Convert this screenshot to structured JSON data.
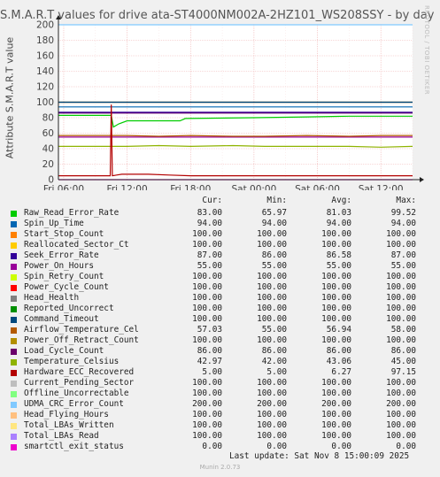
{
  "chart_data": {
    "type": "line",
    "title": "S.M.A.R.T values for drive ata-ST4000NM002A-2HZ101_WS208SSY - by day",
    "ylabel": "Attribute S.M.A.R.T value",
    "ylim": [
      0,
      200
    ],
    "yticks": [
      0,
      20,
      40,
      60,
      80,
      100,
      120,
      140,
      160,
      180,
      200
    ],
    "xlim_hours": [
      -33.5,
      0
    ],
    "x_ticks": [
      "Fri 06:00",
      "Fri 12:00",
      "Fri 18:00",
      "Sat 00:00",
      "Sat 06:00",
      "Sat 12:00"
    ],
    "grid": true,
    "series": [
      {
        "name": "Raw_Read_Error_Rate",
        "color": "#00cc00",
        "constant": null
      },
      {
        "name": "Spin_Up_Time",
        "color": "#0066b3",
        "constant": 94
      },
      {
        "name": "Start_Stop_Count",
        "color": "#ff8000",
        "constant": 100
      },
      {
        "name": "Reallocated_Sector_Ct",
        "color": "#ffcc00",
        "constant": 100
      },
      {
        "name": "Seek_Error_Rate",
        "color": "#330099",
        "constant": null
      },
      {
        "name": "Power_On_Hours",
        "color": "#990099",
        "constant": 55
      },
      {
        "name": "Spin_Retry_Count",
        "color": "#ccff00",
        "constant": 100
      },
      {
        "name": "Power_Cycle_Count",
        "color": "#ff0000",
        "constant": 100
      },
      {
        "name": "Head_Health",
        "color": "#808080",
        "constant": 100
      },
      {
        "name": "Reported_Uncorrect",
        "color": "#008f00",
        "constant": 100
      },
      {
        "name": "Command_Timeout",
        "color": "#00487d",
        "constant": 100
      },
      {
        "name": "Airflow_Temperature_Cel",
        "color": "#b35a00",
        "constant": null
      },
      {
        "name": "Power_Off_Retract_Count",
        "color": "#b38f00",
        "constant": 100
      },
      {
        "name": "Load_Cycle_Count",
        "color": "#6b006b",
        "constant": 86
      },
      {
        "name": "Temperature_Celsius",
        "color": "#8fb300",
        "constant": null
      },
      {
        "name": "Hardware_ECC_Recovered",
        "color": "#b30000",
        "constant": null
      },
      {
        "name": "Current_Pending_Sector",
        "color": "#bebebe",
        "constant": 100
      },
      {
        "name": "Offline_Uncorrectable",
        "color": "#80ff80",
        "constant": 100
      },
      {
        "name": "UDMA_CRC_Error_Count",
        "color": "#80c9ff",
        "constant": 200
      },
      {
        "name": "Head_Flying_Hours",
        "color": "#ffc080",
        "constant": 100
      },
      {
        "name": "Total_LBAs_Written",
        "color": "#ffe680",
        "constant": 100
      },
      {
        "name": "Total_LBAs_Read",
        "color": "#aa80ff",
        "constant": 100
      },
      {
        "name": "smartctl_exit_status",
        "color": "#ee00cc",
        "constant": 0
      }
    ],
    "traces": {
      "Raw_Read_Error_Rate": [
        [
          -33.5,
          83
        ],
        [
          -28.5,
          83
        ],
        [
          -28.3,
          68
        ],
        [
          -27.8,
          72
        ],
        [
          -27,
          76
        ],
        [
          -22,
          76
        ],
        [
          -21.5,
          79
        ],
        [
          -15,
          80
        ],
        [
          -10,
          81
        ],
        [
          -6,
          82
        ],
        [
          0,
          82
        ]
      ],
      "Seek_Error_Rate": [
        [
          -33.5,
          87
        ],
        [
          -28.4,
          87
        ],
        [
          -28.3,
          87
        ],
        [
          -27,
          87
        ],
        [
          -17,
          87
        ],
        [
          0,
          87
        ]
      ],
      "Airflow_Temperature_Cel": [
        [
          -33.5,
          57
        ],
        [
          -30,
          57
        ],
        [
          -28.5,
          57
        ],
        [
          -27,
          57
        ],
        [
          -24,
          56
        ],
        [
          -21,
          57
        ],
        [
          -17,
          56
        ],
        [
          -14,
          56
        ],
        [
          -10,
          57
        ],
        [
          -6,
          56
        ],
        [
          -3,
          57
        ],
        [
          0,
          57
        ]
      ],
      "Temperature_Celsius": [
        [
          -33.5,
          43
        ],
        [
          -30,
          43
        ],
        [
          -27,
          43
        ],
        [
          -24,
          44
        ],
        [
          -21,
          43
        ],
        [
          -17,
          44
        ],
        [
          -14,
          43
        ],
        [
          -10,
          43
        ],
        [
          -6,
          43
        ],
        [
          -3,
          42
        ],
        [
          0,
          43
        ]
      ],
      "Hardware_ECC_Recovered": [
        [
          -33.5,
          5
        ],
        [
          -28.6,
          5
        ],
        [
          -28.5,
          97
        ],
        [
          -28.4,
          5
        ],
        [
          -28,
          6
        ],
        [
          -27.5,
          7
        ],
        [
          -25,
          7
        ],
        [
          -23,
          6
        ],
        [
          -21,
          5
        ],
        [
          0,
          5
        ]
      ]
    }
  },
  "legend": {
    "headers": {
      "cur": "Cur:",
      "min": "Min:",
      "avg": "Avg:",
      "max": "Max:"
    },
    "rows": [
      {
        "name": "Raw_Read_Error_Rate",
        "cur": "83.00",
        "min": "65.97",
        "avg": "81.03",
        "max": "99.52"
      },
      {
        "name": "Spin_Up_Time",
        "cur": "94.00",
        "min": "94.00",
        "avg": "94.00",
        "max": "94.00"
      },
      {
        "name": "Start_Stop_Count",
        "cur": "100.00",
        "min": "100.00",
        "avg": "100.00",
        "max": "100.00"
      },
      {
        "name": "Reallocated_Sector_Ct",
        "cur": "100.00",
        "min": "100.00",
        "avg": "100.00",
        "max": "100.00"
      },
      {
        "name": "Seek_Error_Rate",
        "cur": "87.00",
        "min": "86.00",
        "avg": "86.58",
        "max": "87.00"
      },
      {
        "name": "Power_On_Hours",
        "cur": "55.00",
        "min": "55.00",
        "avg": "55.00",
        "max": "55.00"
      },
      {
        "name": "Spin_Retry_Count",
        "cur": "100.00",
        "min": "100.00",
        "avg": "100.00",
        "max": "100.00"
      },
      {
        "name": "Power_Cycle_Count",
        "cur": "100.00",
        "min": "100.00",
        "avg": "100.00",
        "max": "100.00"
      },
      {
        "name": "Head_Health",
        "cur": "100.00",
        "min": "100.00",
        "avg": "100.00",
        "max": "100.00"
      },
      {
        "name": "Reported_Uncorrect",
        "cur": "100.00",
        "min": "100.00",
        "avg": "100.00",
        "max": "100.00"
      },
      {
        "name": "Command_Timeout",
        "cur": "100.00",
        "min": "100.00",
        "avg": "100.00",
        "max": "100.00"
      },
      {
        "name": "Airflow_Temperature_Cel",
        "cur": "57.03",
        "min": "55.00",
        "avg": "56.94",
        "max": "58.00"
      },
      {
        "name": "Power_Off_Retract_Count",
        "cur": "100.00",
        "min": "100.00",
        "avg": "100.00",
        "max": "100.00"
      },
      {
        "name": "Load_Cycle_Count",
        "cur": "86.00",
        "min": "86.00",
        "avg": "86.00",
        "max": "86.00"
      },
      {
        "name": "Temperature_Celsius",
        "cur": "42.97",
        "min": "42.00",
        "avg": "43.06",
        "max": "45.00"
      },
      {
        "name": "Hardware_ECC_Recovered",
        "cur": "5.00",
        "min": "5.00",
        "avg": "6.27",
        "max": "97.15"
      },
      {
        "name": "Current_Pending_Sector",
        "cur": "100.00",
        "min": "100.00",
        "avg": "100.00",
        "max": "100.00"
      },
      {
        "name": "Offline_Uncorrectable",
        "cur": "100.00",
        "min": "100.00",
        "avg": "100.00",
        "max": "100.00"
      },
      {
        "name": "UDMA_CRC_Error_Count",
        "cur": "200.00",
        "min": "200.00",
        "avg": "200.00",
        "max": "200.00"
      },
      {
        "name": "Head_Flying_Hours",
        "cur": "100.00",
        "min": "100.00",
        "avg": "100.00",
        "max": "100.00"
      },
      {
        "name": "Total_LBAs_Written",
        "cur": "100.00",
        "min": "100.00",
        "avg": "100.00",
        "max": "100.00"
      },
      {
        "name": "Total_LBAs_Read",
        "cur": "100.00",
        "min": "100.00",
        "avg": "100.00",
        "max": "100.00"
      },
      {
        "name": "smartctl_exit_status",
        "cur": "0.00",
        "min": "0.00",
        "avg": "0.00",
        "max": "0.00"
      }
    ]
  },
  "footer": {
    "last_update": "Last update: Sat Nov  8 15:00:09 2025",
    "version": "Munin 2.0.73"
  },
  "watermark": "RRDTOOL / TOBI OETIKER"
}
